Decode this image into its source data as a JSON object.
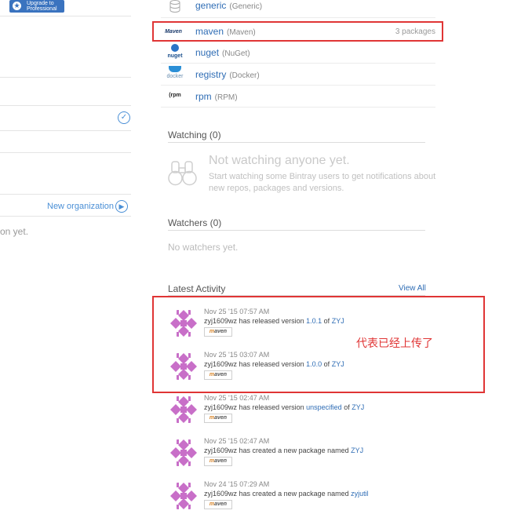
{
  "left": {
    "upgrade_label_1": "Upgrade to",
    "upgrade_label_2": "Professional",
    "new_org": "New organization",
    "empty_note": "on yet."
  },
  "packages": [
    {
      "name": "generic",
      "type": "(Generic)",
      "count": "",
      "icon": "database-icon"
    },
    {
      "name": "maven",
      "type": "(Maven)",
      "count": "3 packages",
      "icon": "maven-icon",
      "icon_text": "Maven"
    },
    {
      "name": "nuget",
      "type": "(NuGet)",
      "count": "",
      "icon": "nuget-icon",
      "icon_text": "nuget"
    },
    {
      "name": "registry",
      "type": "(Docker)",
      "count": "",
      "icon": "docker-icon",
      "icon_text": "docker"
    },
    {
      "name": "rpm",
      "type": "(RPM)",
      "count": "",
      "icon": "rpm-icon",
      "icon_text": "rpm"
    }
  ],
  "watching": {
    "title": "Watching",
    "count": "(0)",
    "empty_title": "Not watching anyone yet.",
    "empty_desc": "Start watching some Bintray users to get notifications about new repos, packages and versions."
  },
  "watchers": {
    "title": "Watchers",
    "count": "(0)",
    "empty": "No watchers yet."
  },
  "activity": {
    "title": "Latest Activity",
    "view_all": "View All",
    "badge_m": "m",
    "badge_rest": "aven",
    "items": [
      {
        "date": "Nov 25 '15 07:57 AM",
        "user": "zyj1609wz",
        "action": "has released version",
        "target": "1.0.1",
        "of": "of",
        "repo": "ZYJ"
      },
      {
        "date": "Nov 25 '15 03:07 AM",
        "user": "zyj1609wz",
        "action": "has released version",
        "target": "1.0.0",
        "of": "of",
        "repo": "ZYJ"
      },
      {
        "date": "Nov 25 '15 02:47 AM",
        "user": "zyj1609wz",
        "action": "has released version",
        "target": "unspecified",
        "of": "of",
        "repo": "ZYJ"
      },
      {
        "date": "Nov 25 '15 02:47 AM",
        "user": "zyj1609wz",
        "action": "has created a new package named",
        "target": "ZYJ",
        "of": "",
        "repo": ""
      },
      {
        "date": "Nov 24 '15 07:29 AM",
        "user": "zyj1609wz",
        "action": "has created a new package named",
        "target": "zyjutil",
        "of": "",
        "repo": ""
      }
    ]
  },
  "annotation": "代表已经上传了",
  "colors": {
    "accent": "#2f6db5",
    "highlight": "#e03535",
    "avatar": "#c86fc8"
  }
}
